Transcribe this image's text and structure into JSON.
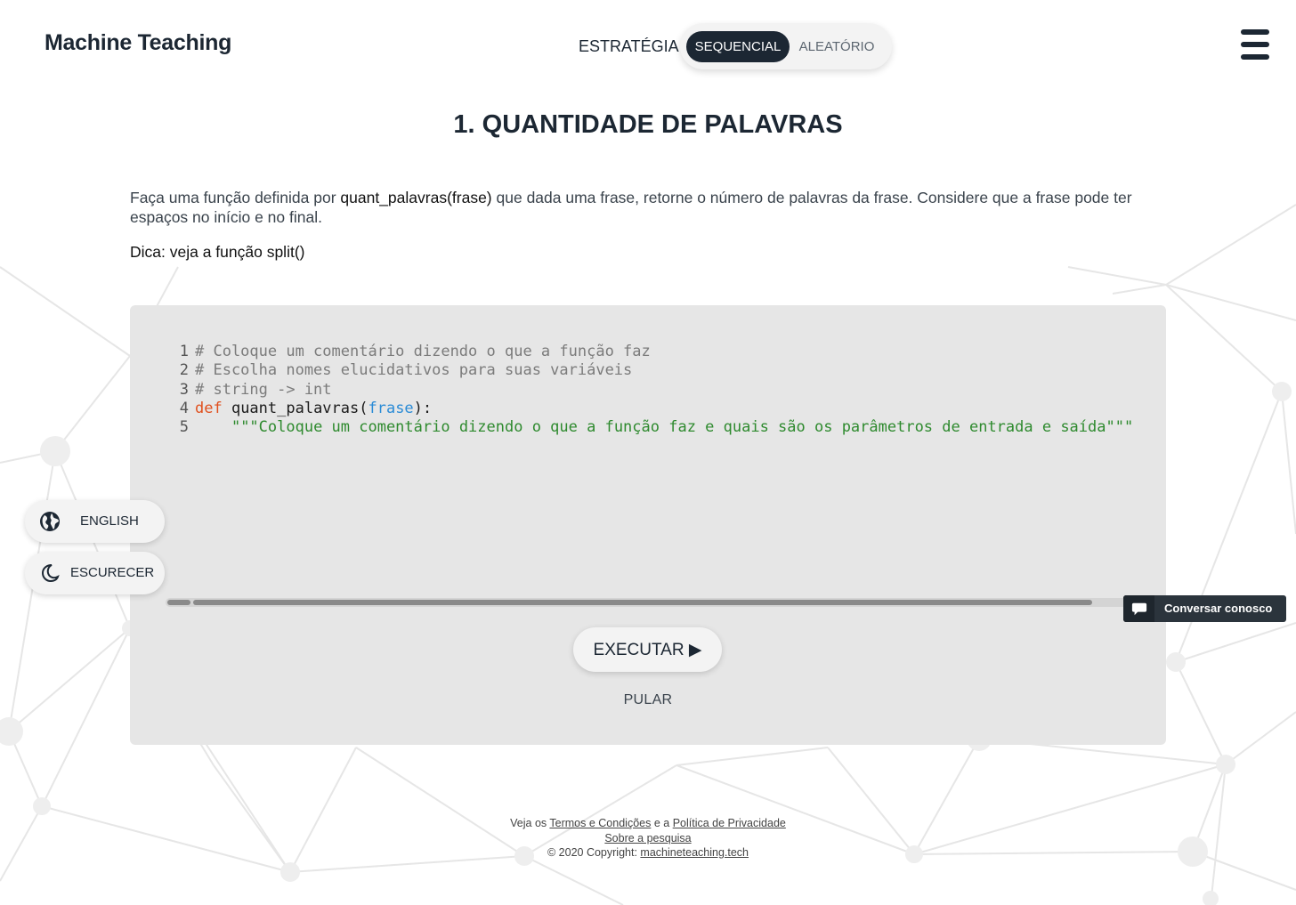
{
  "header": {
    "brand": "Machine Teaching",
    "strategy_label": "ESTRATÉGIA",
    "strategy_options": [
      {
        "label": "SEQUENCIAL",
        "selected": true
      },
      {
        "label": "ALEATÓRIO",
        "selected": false
      }
    ],
    "menu_icon": "hamburger-menu-icon"
  },
  "exercise": {
    "title": "1. QUANTIDADE DE PALAVRAS",
    "description_before": "Faça uma função definida por ",
    "description_function": "quant_palavras(frase)",
    "description_after": " que dada uma frase, retorne o número de palavras da frase. Considere que a frase pode ter espaços no início e no final.",
    "hint": "Dica: veja a função split()"
  },
  "editor": {
    "lines": [
      {
        "number": "1",
        "comment": "# Coloque um comentário dizendo o que a função faz"
      },
      {
        "number": "2",
        "comment": "# Escolha nomes elucidativos para suas variáveis"
      },
      {
        "number": "3",
        "comment": "# string -> int"
      },
      {
        "number": "4",
        "keyword": "def",
        "name": " quant_palavras(",
        "param": "frase",
        "close": "):"
      },
      {
        "number": "5",
        "indent": "    ",
        "string": "\"\"\"Coloque um comentário dizendo o que a função faz e quais são os parâmetros de entrada e saída\"\"\""
      }
    ],
    "run_label": "EXECUTAR ▶",
    "skip_label": "PULAR"
  },
  "side_buttons": {
    "language": {
      "label": "ENGLISH",
      "icon": "globe-icon"
    },
    "theme": {
      "label": "ESCURECER",
      "icon": "moon-icon"
    }
  },
  "chat": {
    "label": "Conversar conosco",
    "icon": "chat-bubble-icon"
  },
  "footer": {
    "prefix": "Veja os ",
    "terms": "Termos e Condições",
    "middle": " e a ",
    "privacy": "Política de Privacidade",
    "about": "Sobre a pesquisa",
    "copyright_prefix": "© 2020 Copyright: ",
    "site": "machineteaching.tech"
  },
  "colors": {
    "primary": "#1c2733",
    "panel": "#e6e6e6",
    "keyword": "#e0501e",
    "param": "#2a8bd6",
    "string": "#2e8a2e",
    "comment": "#7b7b7b"
  }
}
